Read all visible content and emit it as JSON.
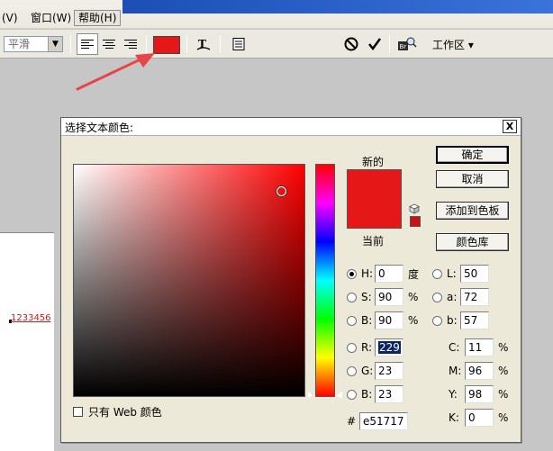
{
  "menubar": {
    "items": [
      "(V)",
      "窗口(W)",
      "帮助(H)"
    ]
  },
  "toolbar": {
    "antialias_value": "平滑",
    "text_color": "#e51717",
    "workspace_label": "工作区 ▾"
  },
  "canvas": {
    "sample_text": "1233456"
  },
  "dialog": {
    "title": "选择文本颜色:",
    "close_label": "X",
    "new_label": "新的",
    "current_label": "当前",
    "new_color": "#e51717",
    "current_color": "#e51717",
    "web_color": "#cc1111",
    "buttons": {
      "ok": "确定",
      "cancel": "取消",
      "add_swatch": "添加到色板",
      "color_library": "颜色库"
    },
    "hsb": {
      "h_label": "H:",
      "h_value": "0",
      "h_unit": "度",
      "s_label": "S:",
      "s_value": "90",
      "s_unit": "%",
      "b_label": "B:",
      "b_value": "90",
      "b_unit": "%"
    },
    "rgb": {
      "r_label": "R:",
      "r_value": "229",
      "g_label": "G:",
      "g_value": "23",
      "b_label": "B:",
      "b_value": "23"
    },
    "lab": {
      "l_label": "L:",
      "l_value": "50",
      "a_label": "a:",
      "a_value": "72",
      "b_label": "b:",
      "b_value": "57"
    },
    "cmyk": {
      "c_label": "C:",
      "c_value": "11",
      "c_unit": "%",
      "m_label": "M:",
      "m_value": "96",
      "m_unit": "%",
      "y_label": "Y:",
      "y_value": "98",
      "y_unit": "%",
      "k_label": "K:",
      "k_value": "0",
      "k_unit": "%"
    },
    "hex_label": "#",
    "hex_value": "e51717",
    "web_only_label": "只有 Web 颜色"
  },
  "colors": {
    "annotation_arrow": "#e8454b"
  }
}
